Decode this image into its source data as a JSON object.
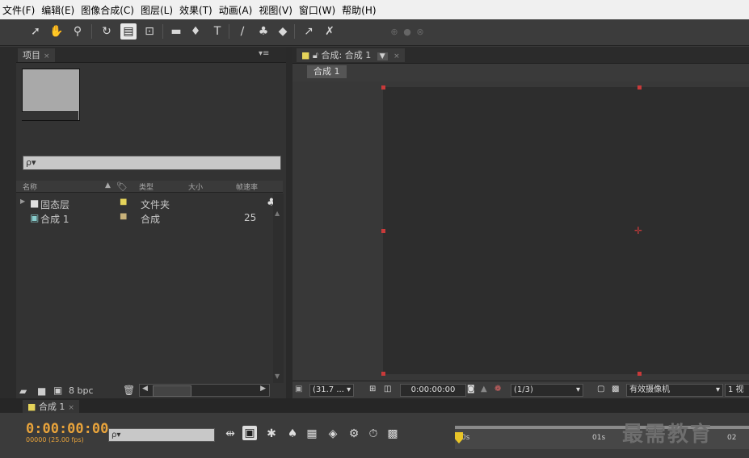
{
  "menu": [
    "文件(F)",
    "编辑(E)",
    "图像合成(C)",
    "图层(L)",
    "效果(T)",
    "动画(A)",
    "视图(V)",
    "窗口(W)",
    "帮助(H)"
  ],
  "project": {
    "tab": "项目",
    "search_placeholder": "ρ▾",
    "columns": {
      "name": "名称",
      "type": "类型",
      "size": "大小",
      "fps": "帧速率"
    },
    "items": [
      {
        "name": "固态层",
        "type": "文件夹",
        "fps": "",
        "color": "#e6d45a"
      },
      {
        "name": "合成 1",
        "type": "合成",
        "fps": "25",
        "color": "#c9b27a"
      }
    ],
    "bpc": "8 bpc"
  },
  "composition": {
    "tab": "合成: 合成 1",
    "breadcrumb": "合成 1",
    "zoom": "(31.7 ...",
    "timecode": "0:00:00:00",
    "resolution": "(1/3)",
    "camera": "有效摄像机",
    "views": "1 视"
  },
  "timeline": {
    "tab": "合成 1",
    "timecode": "0:00:00:00",
    "frames": "00000 (25.00 fps)",
    "search_placeholder": "ρ▾",
    "ticks": [
      "0s",
      "01s",
      "02"
    ]
  },
  "watermark": "最需教育"
}
